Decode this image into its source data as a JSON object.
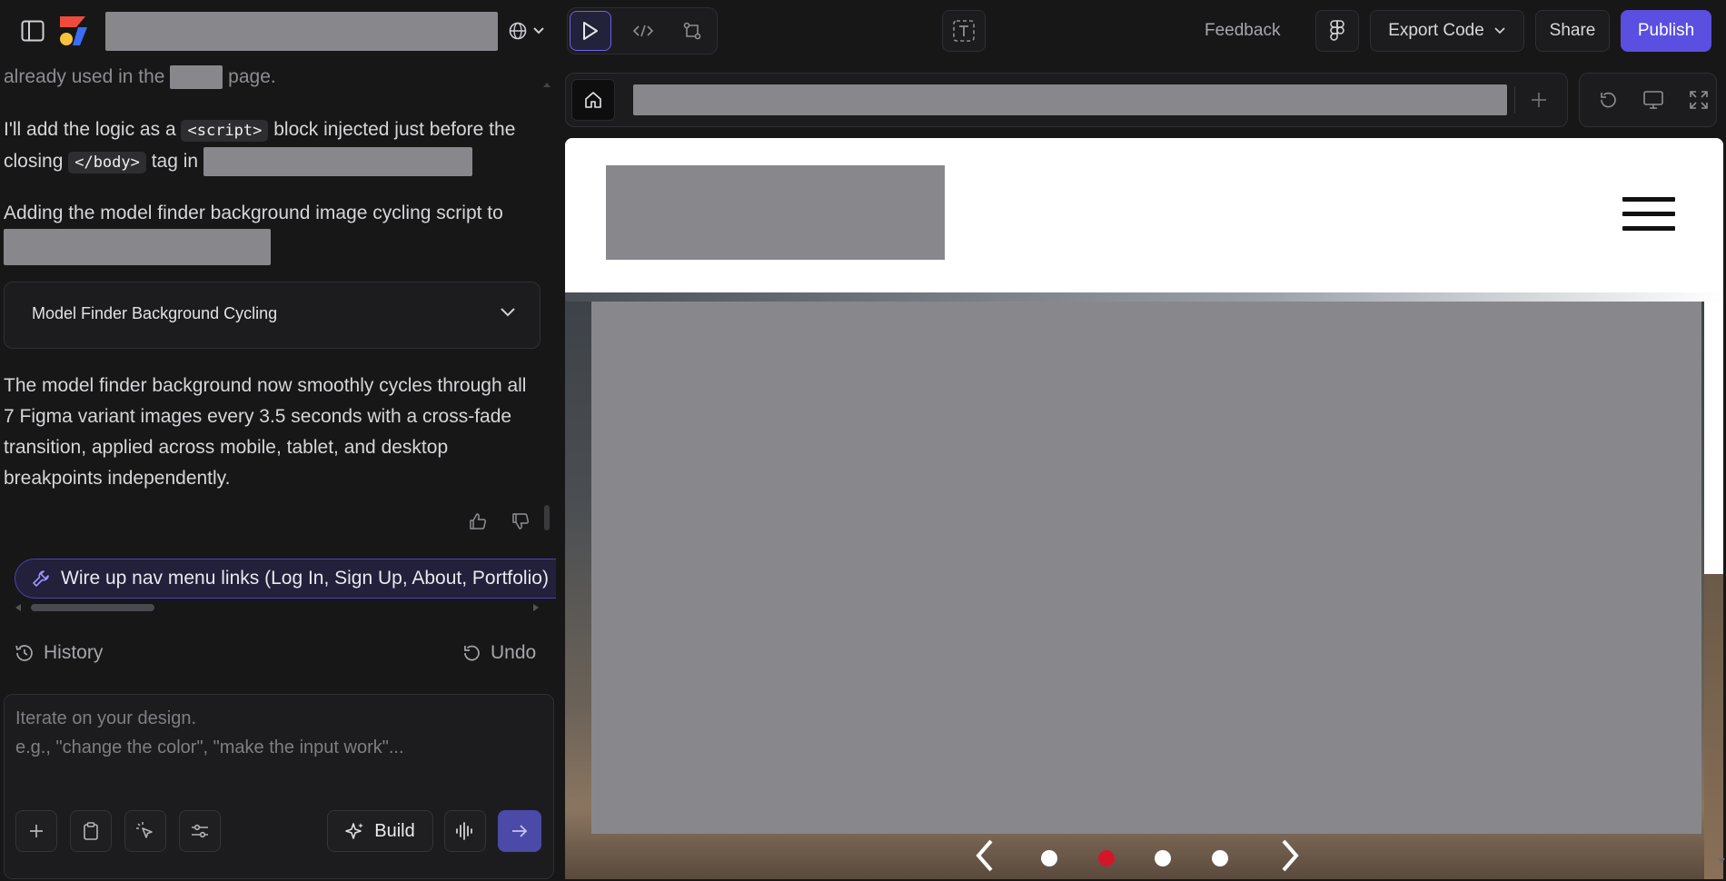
{
  "topbar": {
    "view_modes": [
      "preview",
      "code",
      "versions"
    ],
    "feedback_label": "Feedback",
    "export_label": "Export Code",
    "share_label": "Share",
    "publish_label": "Publish"
  },
  "chat": {
    "line_faded": "already used in the",
    "line_faded_end": "page.",
    "para1_a": "I'll add the logic as a",
    "para1_code1": "<script>",
    "para1_b": "block injected just before the closing",
    "para1_code2": "</body>",
    "para1_c": "tag in",
    "para2": "Adding the model finder background image cycling script to",
    "card_title": "Model Finder Background Cycling",
    "para3": "The model finder background now smoothly cycles through all 7 Figma variant images every 3.5 seconds with a cross-fade transition, applied across mobile, tablet, and desktop breakpoints independently.",
    "suggestion": "Wire up nav menu links (Log In, Sign Up, About, Portfolio)",
    "history_label": "History",
    "undo_label": "Undo",
    "composer_placeholder": "Iterate on your design.\ne.g., \"change the color\", \"make the input work\"...",
    "build_label": "Build"
  },
  "colors": {
    "accent": "#5a4fe0",
    "active_dot": "#d4162b",
    "redacted": "#88888c"
  },
  "carousel": {
    "dot_count": 4,
    "active_index": 1
  }
}
